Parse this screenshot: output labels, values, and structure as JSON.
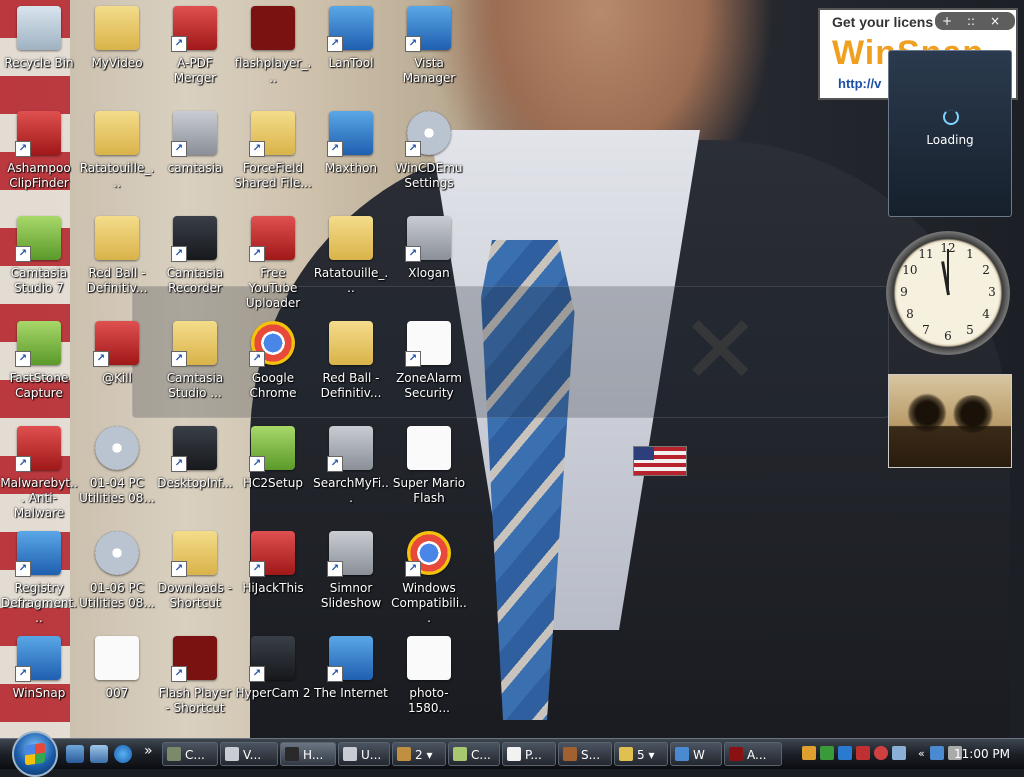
{
  "desktop": {
    "icons": [
      {
        "label": "Recycle Bin",
        "icon": "recycle-bin-icon",
        "shortcut": false,
        "style": "bin"
      },
      {
        "label": "MyVideo",
        "icon": "folder-icon",
        "shortcut": false,
        "style": "folder"
      },
      {
        "label": "A-PDF Merger",
        "icon": "pdf-icon",
        "shortcut": true,
        "style": "red"
      },
      {
        "label": "flashplayer_...",
        "icon": "flash-icon",
        "shortcut": false,
        "style": "flash"
      },
      {
        "label": "LanTool",
        "icon": "network-icon",
        "shortcut": true,
        "style": "blue"
      },
      {
        "label": "Vista Manager",
        "icon": "tools-icon",
        "shortcut": true,
        "style": "blue"
      },
      {
        "label": "Ashampoo ClipFinder",
        "icon": "clip-icon",
        "shortcut": true,
        "style": "red"
      },
      {
        "label": "Ratatouille_...",
        "icon": "folder-icon",
        "shortcut": false,
        "style": "folder"
      },
      {
        "label": "camtasia",
        "icon": "camtasia-icon",
        "shortcut": true,
        "style": "gray"
      },
      {
        "label": "ForceField Shared File...",
        "icon": "folder-icon",
        "shortcut": true,
        "style": "folder"
      },
      {
        "label": "Maxthon",
        "icon": "maxthon-icon",
        "shortcut": true,
        "style": "blue"
      },
      {
        "label": "WinCDEmu Settings",
        "icon": "disc-icon",
        "shortcut": true,
        "style": "disc"
      },
      {
        "label": "Camtasia Studio 7",
        "icon": "camtasia-icon",
        "shortcut": true,
        "style": "green"
      },
      {
        "label": "Red Ball - Definitiv...",
        "icon": "folder-icon",
        "shortcut": false,
        "style": "folder"
      },
      {
        "label": "Camtasia Recorder",
        "icon": "camera-icon",
        "shortcut": true,
        "style": "dark"
      },
      {
        "label": "Free YouTube Uploader",
        "icon": "rocket-icon",
        "shortcut": true,
        "style": "red"
      },
      {
        "label": "Ratatouille_...",
        "icon": "zip-folder-icon",
        "shortcut": false,
        "style": "folder"
      },
      {
        "label": "Xlogan",
        "icon": "server-icon",
        "shortcut": true,
        "style": "gray"
      },
      {
        "label": "FastStone Capture",
        "icon": "capture-icon",
        "shortcut": true,
        "style": "green"
      },
      {
        "label": "@Kill",
        "icon": "kill-icon",
        "shortcut": true,
        "style": "red"
      },
      {
        "label": "Camtasia Studio ...",
        "icon": "folder-icon",
        "shortcut": true,
        "style": "folder"
      },
      {
        "label": "Google Chrome",
        "icon": "chrome-icon",
        "shortcut": true,
        "style": "chrome"
      },
      {
        "label": "Red Ball - Definitiv...",
        "icon": "zip-folder-icon",
        "shortcut": false,
        "style": "folder"
      },
      {
        "label": "ZoneAlarm Security",
        "icon": "zonealarm-icon",
        "shortcut": true,
        "style": "doc"
      },
      {
        "label": "Malwarebyt... Anti-Malware",
        "icon": "malwarebytes-icon",
        "shortcut": true,
        "style": "red"
      },
      {
        "label": "01-04 PC Utilities 08...",
        "icon": "disc-icon",
        "shortcut": false,
        "style": "disc"
      },
      {
        "label": "DesktopInf...",
        "icon": "monitor-icon",
        "shortcut": true,
        "style": "dark"
      },
      {
        "label": "HC2Setup",
        "icon": "setup-icon",
        "shortcut": true,
        "style": "green"
      },
      {
        "label": "SearchMyFi...",
        "icon": "search-window-icon",
        "shortcut": true,
        "style": "gray"
      },
      {
        "label": "Super Mario Flash",
        "icon": "document-icon",
        "shortcut": false,
        "style": "doc"
      },
      {
        "label": "Registry Defragment...",
        "icon": "registry-icon",
        "shortcut": true,
        "style": "blue"
      },
      {
        "label": "01-06 PC Utilities 08...",
        "icon": "disc-icon",
        "shortcut": false,
        "style": "disc"
      },
      {
        "label": "Downloads - Shortcut",
        "icon": "folder-icon",
        "shortcut": true,
        "style": "folder"
      },
      {
        "label": "HiJackThis",
        "icon": "hijackthis-icon",
        "shortcut": true,
        "style": "red"
      },
      {
        "label": "Simnor Slideshow",
        "icon": "slideshow-icon",
        "shortcut": true,
        "style": "gray"
      },
      {
        "label": "Windows Compatibili...",
        "icon": "chrome-icon",
        "shortcut": true,
        "style": "chrome"
      },
      {
        "label": "WinSnap",
        "icon": "winsnap-icon",
        "shortcut": true,
        "style": "blue"
      },
      {
        "label": "007",
        "icon": "mp3-file-icon",
        "shortcut": false,
        "style": "doc"
      },
      {
        "label": "Flash Player - Shortcut",
        "icon": "flash-icon",
        "shortcut": true,
        "style": "flash"
      },
      {
        "label": "HyperCam 2",
        "icon": "film-icon",
        "shortcut": true,
        "style": "dark"
      },
      {
        "label": "The Internet",
        "icon": "network-icon",
        "shortcut": true,
        "style": "blue"
      },
      {
        "label": "photo-1580...",
        "icon": "photo-icon",
        "shortcut": false,
        "style": "doc"
      }
    ]
  },
  "gadgets": {
    "ad": {
      "title": "Get your licens",
      "brand": "WinSnap",
      "url": "http://v"
    },
    "controls": {
      "add": "+",
      "drag": "::",
      "close": "×"
    },
    "loading": {
      "text": "Loading"
    },
    "clock": {
      "numbers": [
        "12",
        "1",
        "2",
        "3",
        "4",
        "5",
        "6",
        "7",
        "8",
        "9",
        "10",
        "11"
      ]
    }
  },
  "taskbar": {
    "quick_launch": [
      "show-desktop-icon",
      "switch-windows-icon",
      "internet-explorer-icon"
    ],
    "chevron": "»",
    "tasks": [
      {
        "label": "C..."
      },
      {
        "label": "V..."
      },
      {
        "label": "H...",
        "active": true
      },
      {
        "label": "U..."
      },
      {
        "label": "2",
        "dropdown": true
      },
      {
        "label": "C..."
      },
      {
        "label": "P..."
      },
      {
        "label": "S..."
      },
      {
        "label": "5",
        "dropdown": true
      },
      {
        "label": "W"
      },
      {
        "label": "A..."
      }
    ],
    "tray": {
      "chevron": "«",
      "clock": "11:00 PM"
    }
  }
}
